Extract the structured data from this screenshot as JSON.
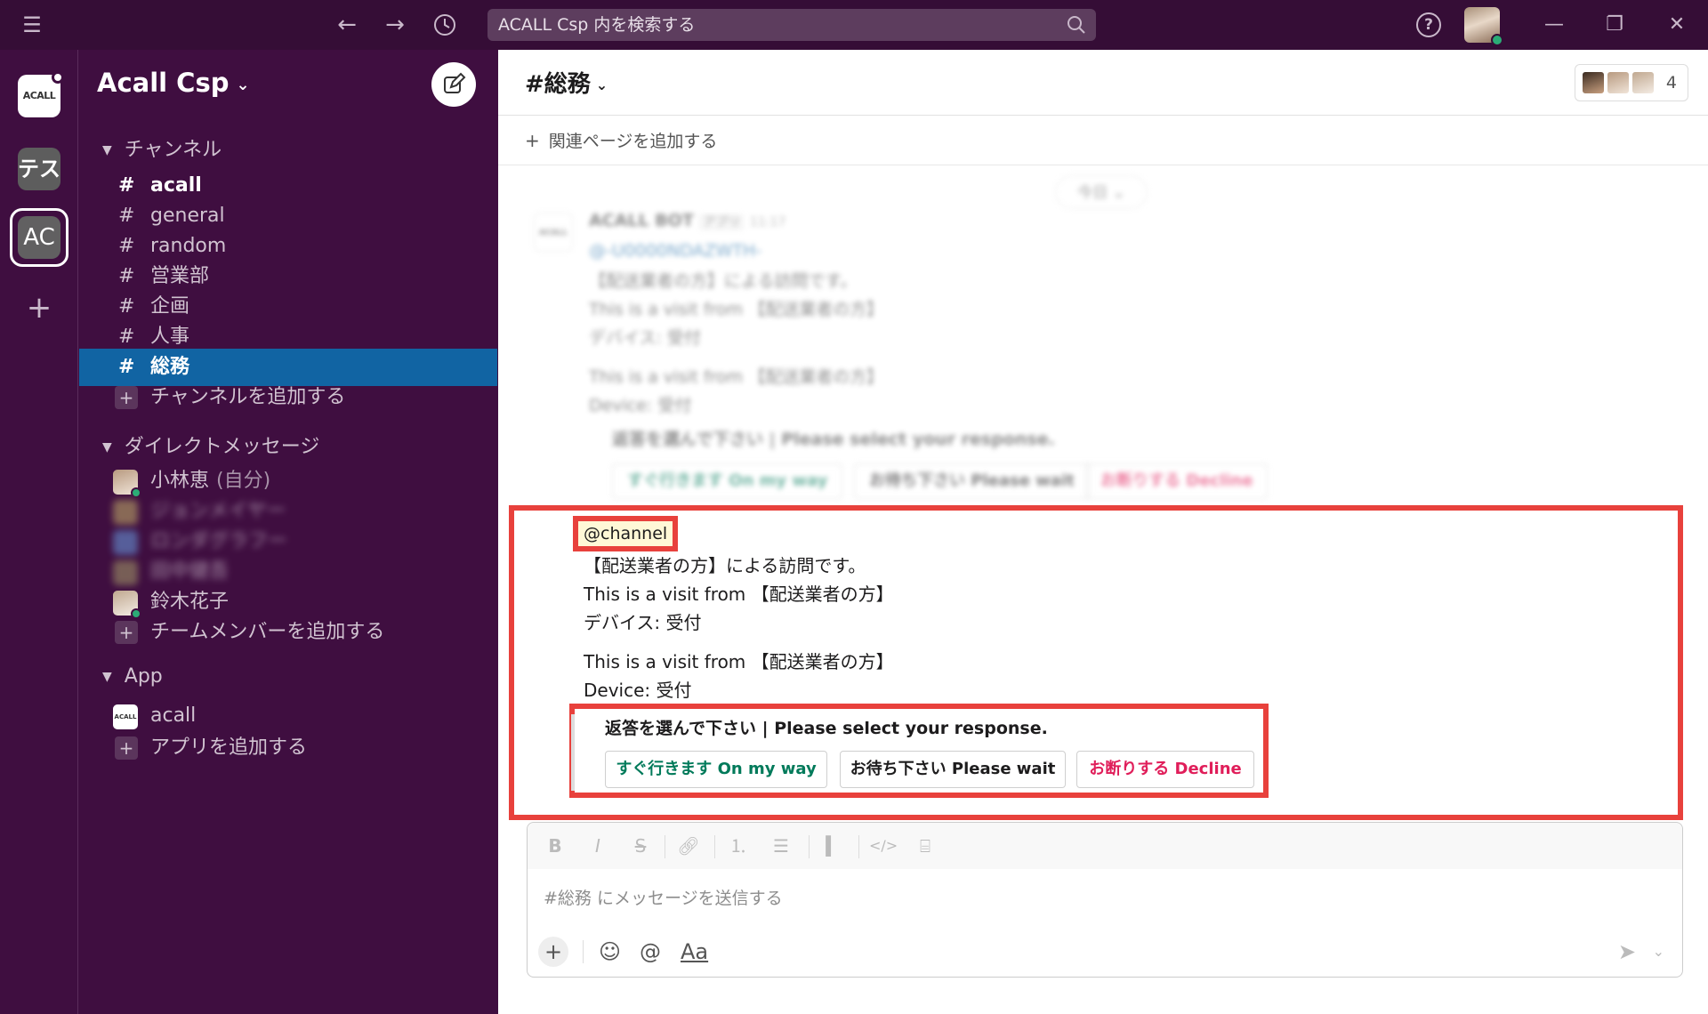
{
  "topbar": {
    "search_placeholder": "ACALL Csp 内を検索する",
    "help": "?"
  },
  "workspaces": [
    {
      "label": "ACALL"
    },
    {
      "label": "テス"
    },
    {
      "label": "AC"
    }
  ],
  "sidebar": {
    "team_name": "Acall Csp",
    "channels_header": "チャンネル",
    "channels": [
      {
        "name": "acall"
      },
      {
        "name": "general"
      },
      {
        "name": "random"
      },
      {
        "name": "営業部"
      },
      {
        "name": "企画"
      },
      {
        "name": "人事"
      },
      {
        "name": "総務"
      }
    ],
    "add_channel": "チャンネルを追加する",
    "dm_header": "ダイレクトメッセージ",
    "dms": [
      {
        "name": "小林恵",
        "suffix": "(自分)"
      },
      {
        "name": "ジョンメイヤー"
      },
      {
        "name": "ロンダグラフー"
      },
      {
        "name": "田中健吾"
      },
      {
        "name": "鈴木花子"
      }
    ],
    "add_member": "チームメンバーを追加する",
    "app_header": "App",
    "apps": [
      {
        "name": "acall",
        "icon_text": "ACALL"
      }
    ],
    "add_app": "アプリを追加する"
  },
  "channel": {
    "title": "#総務",
    "member_count": "4",
    "add_bookmark": "関連ページを追加する"
  },
  "history": {
    "date_pill": "今日",
    "sender": "ACALL BOT",
    "app_tag": "アプリ",
    "time": "11:17",
    "lines": [
      "@-U0000NDAZWTH-",
      "【配送業者の方】による訪問です。",
      "This is a visit from 【配送業者の方】",
      "デバイス: 受付",
      "This is a visit from 【配送業者の方】",
      "Device: 受付"
    ],
    "prompt": "返答を選んで下さい | Please select your response.",
    "buttons": [
      "すぐ行きます On my way",
      "お待ち下さい Please wait",
      "お断りする Decline"
    ]
  },
  "message": {
    "mention": "@channel",
    "lines": [
      "【配送業者の方】による訪問です。",
      "This is a visit from 【配送業者の方】",
      "デバイス: 受付",
      "This is a visit from 【配送業者の方】",
      "Device: 受付"
    ],
    "attachment_title": "返答を選んで下さい | Please select your response.",
    "buttons": {
      "on_my_way": "すぐ行きます On my way",
      "please_wait": "お待ち下さい Please wait",
      "decline": "お断りする Decline"
    }
  },
  "composer": {
    "placeholder": "#総務 にメッセージを送信する",
    "format_labels": [
      "B",
      "I",
      "S"
    ],
    "mention_symbol": "@",
    "text_format": "Aa"
  },
  "colors": {
    "aubergine": "#3f0e40",
    "topbar": "#350d36",
    "active": "#1164a3",
    "highlight": "#e8413c",
    "green": "#007a5a",
    "red": "#e01e5a",
    "presence": "#2bac76"
  }
}
